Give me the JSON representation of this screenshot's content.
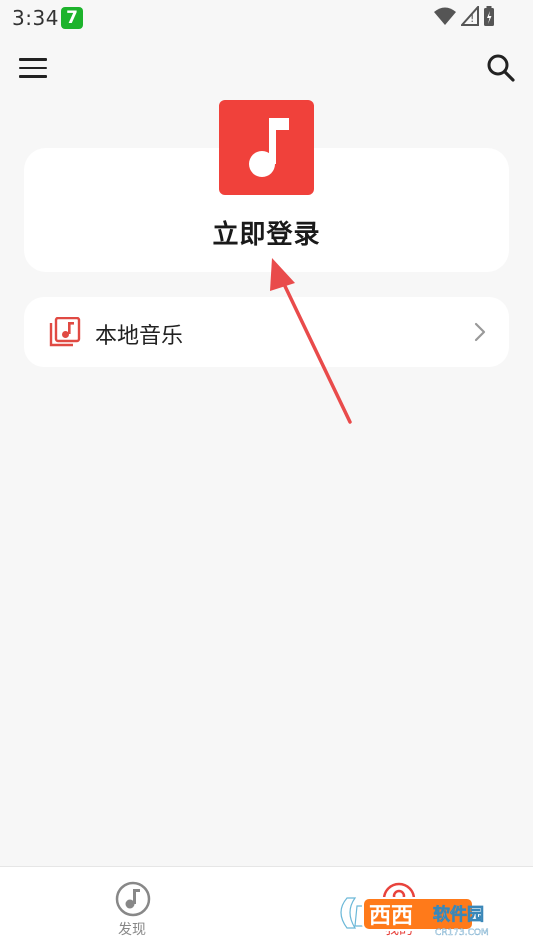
{
  "status_bar": {
    "time": "3:34",
    "app_badge": "7",
    "icons": [
      "wifi-icon",
      "cellular-signal-icon",
      "battery-icon"
    ]
  },
  "app_bar": {
    "menu_icon": "hamburger-menu-icon",
    "search_icon": "search-icon"
  },
  "login_card": {
    "logo_icon": "music-note-icon",
    "label": "立即登录"
  },
  "local_music": {
    "icon": "music-library-icon",
    "label": "本地音乐",
    "chevron": "chevron-right-icon"
  },
  "bottom_nav": {
    "tabs": [
      {
        "label": "发现",
        "icon": "music-note-circle-icon",
        "active": false
      },
      {
        "label": "我的",
        "icon": "profile-icon",
        "active": true
      }
    ]
  },
  "watermark": {
    "text": "西西软件园",
    "sub": "CR173.COM"
  },
  "colors": {
    "accent": "#f0413b",
    "background": "#f7f7f7",
    "card": "#ffffff",
    "active_tab": "#e8433d",
    "inactive_tab": "#888888",
    "annotation_arrow": "#e94b4b"
  }
}
